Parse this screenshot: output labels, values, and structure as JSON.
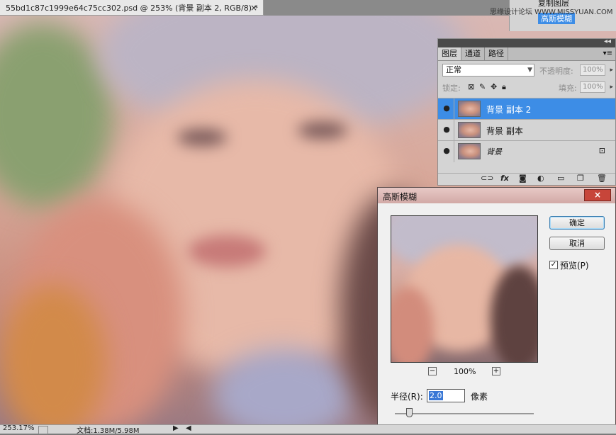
{
  "document": {
    "tab_title": "55bd1c87c1999e64c75cc302.psd @ 253% (背景 副本 2, RGB/8) *",
    "close_glyph": "×"
  },
  "top_widget": {
    "line1": "复制图层",
    "line2": "高斯模糊",
    "watermark": "思缘设计论坛 WWW.MISSYUAN.COM"
  },
  "layers_panel": {
    "collapse_glyph": "◂◂",
    "tabs": [
      {
        "label": "图层"
      },
      {
        "label": "通道"
      },
      {
        "label": "路径"
      }
    ],
    "menu_glyph": "▾≡",
    "blend_mode": "正常",
    "opacity_label": "不透明度:",
    "opacity_value": "100%",
    "lock_label": "锁定:",
    "fill_label": "填充:",
    "fill_value": "100%",
    "layers": [
      {
        "name": "背景 副本 2",
        "selected": true
      },
      {
        "name": "背景 副本",
        "selected": false
      },
      {
        "name": "背景",
        "selected": false,
        "locked": true
      }
    ],
    "bottom_tools": [
      "link-icon",
      "fx-icon",
      "mask-icon",
      "adjustment-icon",
      "folder-icon",
      "new-layer-icon",
      "trash-icon"
    ]
  },
  "dialog": {
    "title": "高斯模糊",
    "close_label": "×",
    "ok_label": "确定",
    "cancel_label": "取消",
    "preview_label": "预览(P)",
    "preview_checked": true,
    "zoom_value": "100%",
    "zoom_minus": "−",
    "zoom_plus": "+",
    "radius_label": "半径(R):",
    "radius_value": "2.0",
    "radius_unit": "像素"
  },
  "status_bar": {
    "zoom": "253.17%",
    "doc_info": "文档:1.38M/5.98M",
    "arrow": "▶",
    "scroll_left": "◀"
  }
}
